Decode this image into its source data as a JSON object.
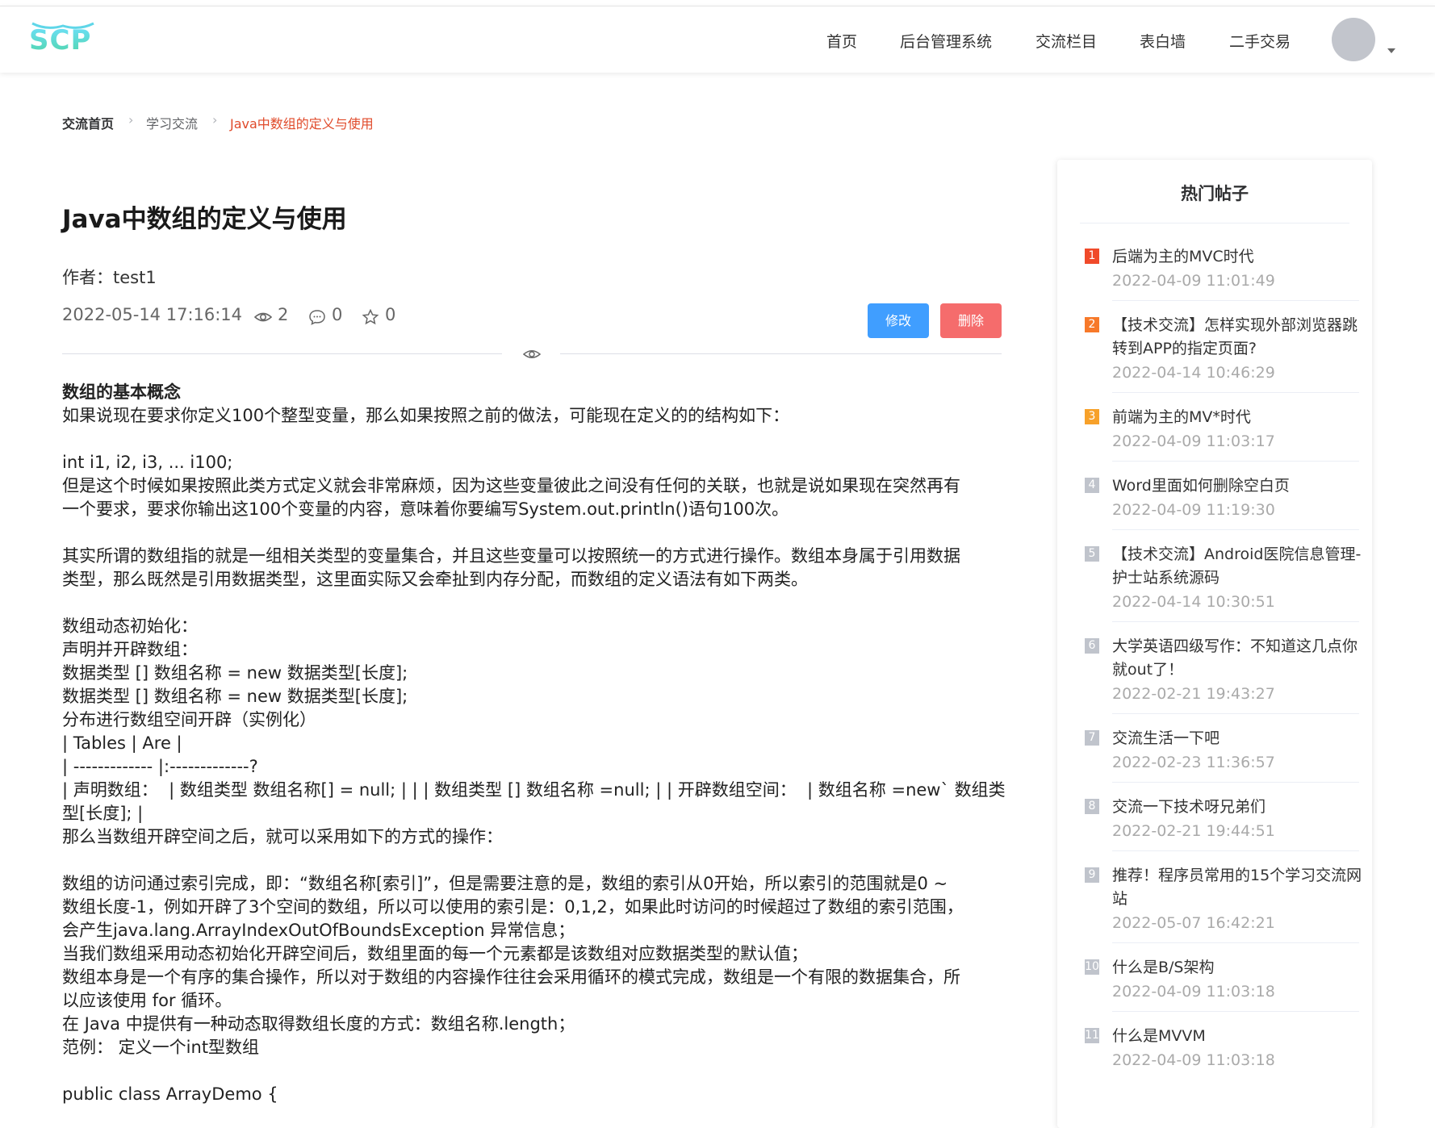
{
  "header": {
    "logo_text": "SCP",
    "nav": [
      {
        "label": "首页"
      },
      {
        "label": "后台管理系统"
      },
      {
        "label": "交流栏目"
      },
      {
        "label": "表白墙"
      },
      {
        "label": "二手交易"
      }
    ]
  },
  "breadcrumb": {
    "home": "交流首页",
    "category": "学习交流",
    "current": "Java中数组的定义与使用"
  },
  "post": {
    "title": "Java中数组的定义与使用",
    "author_line": "作者：test1",
    "date": "2022-05-14 17:16:14",
    "views": "2",
    "comments": "0",
    "stars": "0",
    "edit_label": "修改",
    "delete_label": "删除"
  },
  "content": {
    "lines": [
      "数组的基本概念",
      "如果说现在要求你定义100个整型变量，那么如果按照之前的做法，可能现在定义的的结构如下：",
      "",
      "int i1, i2, i3, ... i100;",
      "但是这个时候如果按照此类方式定义就会非常麻烦，因为这些变量彼此之间没有任何的关联，也就是说如果现在突然再有",
      "一个要求，要求你输出这100个变量的内容，意味着你要编写System.out.println()语句100次。",
      "",
      "其实所谓的数组指的就是一组相关类型的变量集合，并且这些变量可以按照统一的方式进行操作。数组本身属于引用数据",
      "类型，那么既然是引用数据类型，这里面实际又会牵扯到内存分配，而数组的定义语法有如下两类。",
      "",
      "数组动态初始化：",
      "声明并开辟数组：",
      "数据类型 [] 数组名称 = new 数据类型[长度];",
      "数据类型 [] 数组名称 = new 数据类型[长度];",
      "分布进行数组空间开辟（实例化）",
      "| Tables | Are |",
      "| ------------- |:-------------?",
      "| 声明数组：  | 数组类型 数组名称[] = null; | | | 数组类型 [] 数组名称 =null; | | 开辟数组空间：  | 数组名称 =new` 数组类",
      "型[长度]; |",
      "那么当数组开辟空间之后，就可以采用如下的方式的操作：",
      "",
      "数组的访问通过索引完成，即：“数组名称[索引]”，但是需要注意的是，数组的索引从0开始，所以索引的范围就是0 ~",
      "数组长度-1，例如开辟了3个空间的数组，所以可以使用的索引是：0,1,2，如果此时访问的时候超过了数组的索引范围，",
      "会产生java.lang.ArrayIndexOutOfBoundsException 异常信息；",
      "当我们数组采用动态初始化开辟空间后，数组里面的每一个元素都是该数组对应数据类型的默认值；",
      "数组本身是一个有序的集合操作，所以对于数组的内容操作往往会采用循环的模式完成，数组是一个有限的数据集合，所",
      "以应该使用 for 循环。",
      "在 Java 中提供有一种动态取得数组长度的方式：数组名称.length；",
      "范例： 定义一个int型数组",
      "",
      "public class ArrayDemo {"
    ]
  },
  "sidebar": {
    "title": "热门帖子",
    "items": [
      {
        "rank": "1",
        "title": "后端为主的MVC时代",
        "time": "2022-04-09 11:01:49",
        "color": "#f04a2a"
      },
      {
        "rank": "2",
        "title": "【技术交流】怎样实现外部浏览器跳转到APP的指定页面?",
        "time": "2022-04-14 10:46:29",
        "color": "#f7792a"
      },
      {
        "rank": "3",
        "title": "前端为主的MV*时代",
        "time": "2022-04-09 11:03:17",
        "color": "#f7a12a"
      },
      {
        "rank": "4",
        "title": "Word里面如何删除空白页",
        "time": "2022-04-09 11:19:30",
        "color": "#c0c4cc"
      },
      {
        "rank": "5",
        "title": "【技术交流】Android医院信息管理-护士站系统源码",
        "time": "2022-04-14 10:30:51",
        "color": "#c0c4cc"
      },
      {
        "rank": "6",
        "title": "大学英语四级写作：不知道这几点你就out了！",
        "time": "2022-02-21 19:43:27",
        "color": "#c0c4cc"
      },
      {
        "rank": "7",
        "title": "交流生活一下吧",
        "time": "2022-02-23 11:36:57",
        "color": "#c0c4cc"
      },
      {
        "rank": "8",
        "title": "交流一下技术呀兄弟们",
        "time": "2022-02-21 19:44:51",
        "color": "#c0c4cc"
      },
      {
        "rank": "9",
        "title": "推荐！程序员常用的15个学习交流网站",
        "time": "2022-05-07 16:42:21",
        "color": "#c0c4cc"
      },
      {
        "rank": "10",
        "title": "什么是B/S架构",
        "time": "2022-04-09 11:03:18",
        "color": "#c0c4cc"
      },
      {
        "rank": "11",
        "title": "什么是MVVM",
        "time": "2022-04-09 11:03:18",
        "color": "#c0c4cc"
      }
    ]
  }
}
